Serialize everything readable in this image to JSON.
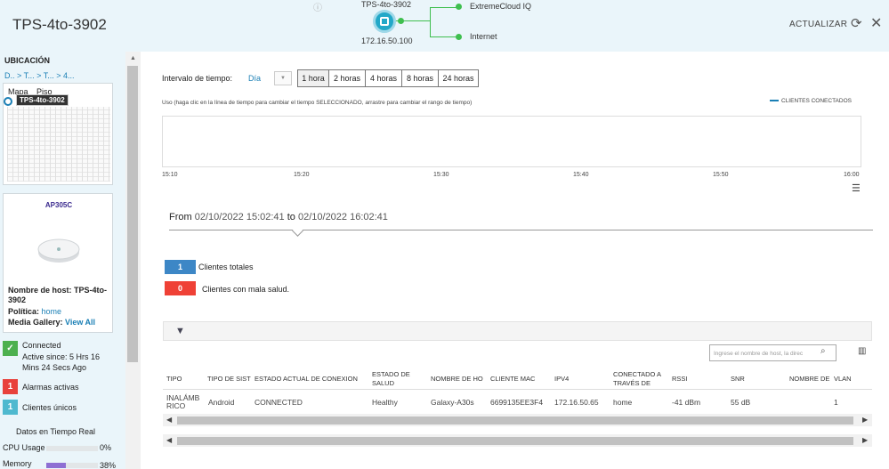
{
  "header": {
    "title": "TPS-4to-3902",
    "topology": {
      "device_name": "TPS-4to-3902",
      "device_ip": "172.16.50.100",
      "uplink_1": "ExtremeCloud IQ",
      "uplink_2": "Internet",
      "status_color": "#3fbf4f"
    },
    "refresh_label": "ACTUALIZAR"
  },
  "left": {
    "location_title": "UBICACIÓN",
    "breadcrumb": "D.. > T... > T... > 4...",
    "map_tab": "Mapa",
    "floor_tab": "Piso",
    "map_device_tag": "TPS-4to-3902",
    "device": {
      "model": "AP305C",
      "hostname_label": "Nombre de host:",
      "hostname_value": "TPS-4to-3902",
      "policy_label": "Política:",
      "policy_value": "home",
      "media_label": "Media Gallery:",
      "media_value": "View All"
    },
    "status": {
      "connected": "Connected",
      "active_since": "Active since: 5 Hrs 16 Mins 24 Secs Ago",
      "alarms_count": "1",
      "alarms_label": "Alarmas activas",
      "clients_count": "1",
      "clients_label": "Clientes únicos"
    },
    "realtime_title": "Datos en Tiempo Real",
    "cpu_label": "CPU Usage",
    "cpu_value": "0%",
    "cpu_fraction": 0.0,
    "memory_label": "Memory",
    "memory_value": "38%",
    "memory_fraction": 0.38
  },
  "main": {
    "interval_label": "Intervalo de tiempo:",
    "interval_select": "Día",
    "range_buttons": [
      "1 hora",
      "2 horas",
      "4 horas",
      "8 horas",
      "24 horas"
    ],
    "usage_note": "Uso (haga clic en la línea de tiempo para cambiar el tiempo SELECCIONADO, arrastre para cambiar el rango de tiempo)",
    "legend": "CLIENTES CONECTADOS",
    "ticks": [
      "15:10",
      "15:20",
      "15:30",
      "15:40",
      "15:50",
      "16:00"
    ],
    "range_from_label": "From",
    "range_from": "02/10/2022 15:02:41",
    "range_to_label": "to",
    "range_to": "02/10/2022 16:02:41",
    "total_clients_count": "1",
    "total_clients_label": "Clientes totales",
    "bad_health_count": "0",
    "bad_health_label": "Clientes con mala salud.",
    "search_placeholder": "Ingrese el nombre de host, la direc",
    "table": {
      "headers": [
        "TIPO",
        "TIPO DE SIST",
        "ESTADO ACTUAL DE CONEXION",
        "ESTADO DE SALUD",
        "NOMBRE DE HO",
        "CLIENTE MAC",
        "IPV4",
        "CONECTADO A TRAVÉS DE",
        "RSSI",
        "SNR",
        "NOMBRE DE",
        "VLAN"
      ],
      "row": [
        "INALÁMBRICO",
        "Android",
        "CONNECTED",
        "Healthy",
        "Galaxy-A30s",
        "6699135EE3F4",
        "172.16.50.65",
        "home",
        "-41 dBm",
        "55 dB",
        "",
        "1"
      ]
    }
  },
  "colors": {
    "accent": "#1a7fb5",
    "connected": "#4cb04f",
    "alarm": "#e8413b",
    "clients": "#4fb9cf",
    "total": "#3d87c6",
    "bad": "#ef4136"
  }
}
